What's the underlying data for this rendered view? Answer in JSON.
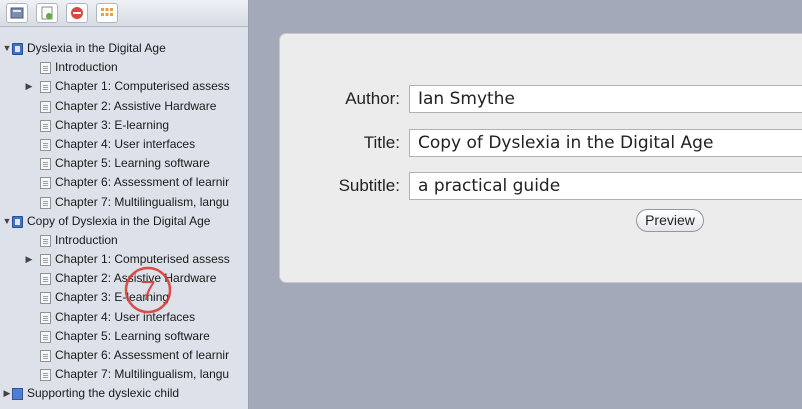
{
  "toolbar": {
    "buttons": [
      {
        "name": "library-button",
        "icon": "library-icon"
      },
      {
        "name": "add-button",
        "icon": "add-doc-icon"
      },
      {
        "name": "remove-button",
        "icon": "remove-icon"
      },
      {
        "name": "grid-button",
        "icon": "grid-icon"
      }
    ]
  },
  "tree": [
    {
      "level": 0,
      "expanded": true,
      "icon": "book",
      "label": "Dyslexia in the Digital Age"
    },
    {
      "level": 1,
      "icon": "doc",
      "label": "Introduction"
    },
    {
      "level": 1,
      "collapsed": true,
      "icon": "doc",
      "label": "Chapter 1: Computerised assess"
    },
    {
      "level": 1,
      "icon": "doc",
      "label": "Chapter 2: Assistive Hardware"
    },
    {
      "level": 1,
      "icon": "doc",
      "label": "Chapter 3: E-learning"
    },
    {
      "level": 1,
      "icon": "doc",
      "label": "Chapter 4: User interfaces"
    },
    {
      "level": 1,
      "icon": "doc",
      "label": "Chapter 5: Learning software"
    },
    {
      "level": 1,
      "icon": "doc",
      "label": "Chapter 6: Assessment of learnir"
    },
    {
      "level": 1,
      "icon": "doc",
      "label": "Chapter 7: Multilingualism, langu"
    },
    {
      "level": 0,
      "expanded": true,
      "icon": "book",
      "label": "Copy of Dyslexia in the Digital Age"
    },
    {
      "level": 1,
      "icon": "doc",
      "label": "Introduction"
    },
    {
      "level": 1,
      "collapsed": true,
      "icon": "doc",
      "label": "Chapter 1: Computerised assess"
    },
    {
      "level": 1,
      "icon": "doc",
      "label": "Chapter 2: Assistive Hardware"
    },
    {
      "level": 1,
      "icon": "doc",
      "label": "Chapter 3: E-learning"
    },
    {
      "level": 1,
      "icon": "doc",
      "label": "Chapter 4: User interfaces"
    },
    {
      "level": 1,
      "icon": "doc",
      "label": "Chapter 5: Learning software"
    },
    {
      "level": 1,
      "icon": "doc",
      "label": "Chapter 6: Assessment of learnir"
    },
    {
      "level": 1,
      "icon": "doc",
      "label": "Chapter 7: Multilingualism, langu"
    },
    {
      "level": 0,
      "collapsed": true,
      "icon": "stack",
      "label": "Supporting the dyslexic child"
    }
  ],
  "form": {
    "author_label": "Author:",
    "author_value": "Ian Smythe",
    "title_label": "Title:",
    "title_value": "Copy of Dyslexia in the Digital Age",
    "subtitle_label": "Subtitle:",
    "subtitle_value": "a practical guide",
    "preview_label": "Preview"
  },
  "annotation": {
    "step_number": "7",
    "color": "#d9342b"
  }
}
